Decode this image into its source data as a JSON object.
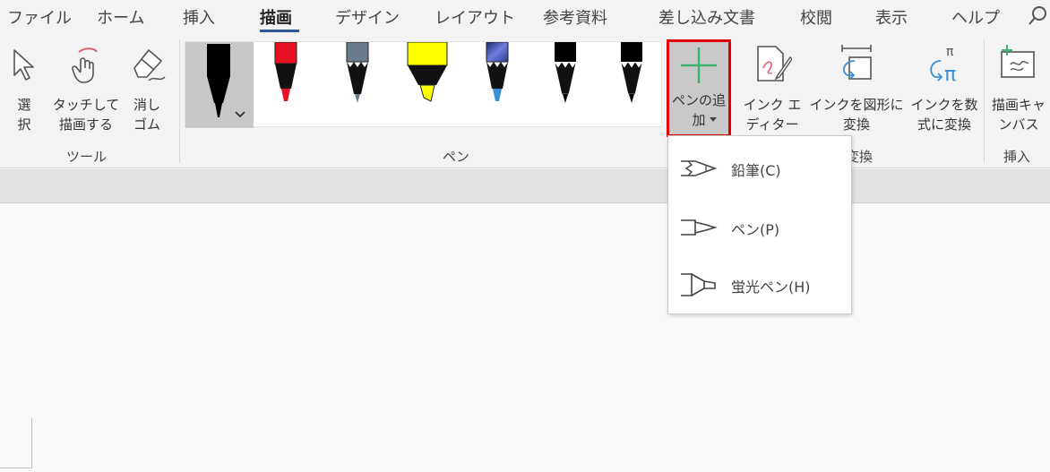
{
  "tabs": [
    {
      "label": "ファイル"
    },
    {
      "label": "ホーム"
    },
    {
      "label": "挿入"
    },
    {
      "label": "描画"
    },
    {
      "label": "デザイン"
    },
    {
      "label": "レイアウト"
    },
    {
      "label": "参考資料"
    },
    {
      "label": "差し込み文書"
    },
    {
      "label": "校閲"
    },
    {
      "label": "表示"
    },
    {
      "label": "ヘルプ"
    }
  ],
  "ribbon": {
    "tools": {
      "select_label": "選\n択",
      "touch_label": "タッチして\n描画する",
      "eraser_label": "消し\nゴム",
      "group_label": "ツール"
    },
    "pens": {
      "group_label": "ペン",
      "colors": [
        "#000000",
        "#e81123",
        "#6b7d8c",
        "#ffff00",
        "#2f6fbd",
        "#000000",
        "#000000"
      ]
    },
    "add_pen_label": "ペンの追\n加",
    "ink_editor_label": "インク エ\nディター",
    "ink_to_shape_label": "インクを図形に\n変換",
    "ink_to_math_label": "インクを数\n式に変換",
    "convert_group_label": "変換",
    "canvas_label": "描画キャ\nンバス",
    "insert_group_label": "挿入"
  },
  "menu": {
    "items": [
      {
        "label": "鉛筆(C)",
        "icon": "pencil-icon"
      },
      {
        "label": "ペン(P)",
        "icon": "pen-icon"
      },
      {
        "label": "蛍光ペン(H)",
        "icon": "highlighter-icon"
      }
    ]
  },
  "colors": {
    "accent": "#2b579a",
    "highlight_border": "#e00000",
    "plus_green": "#3cb371"
  }
}
